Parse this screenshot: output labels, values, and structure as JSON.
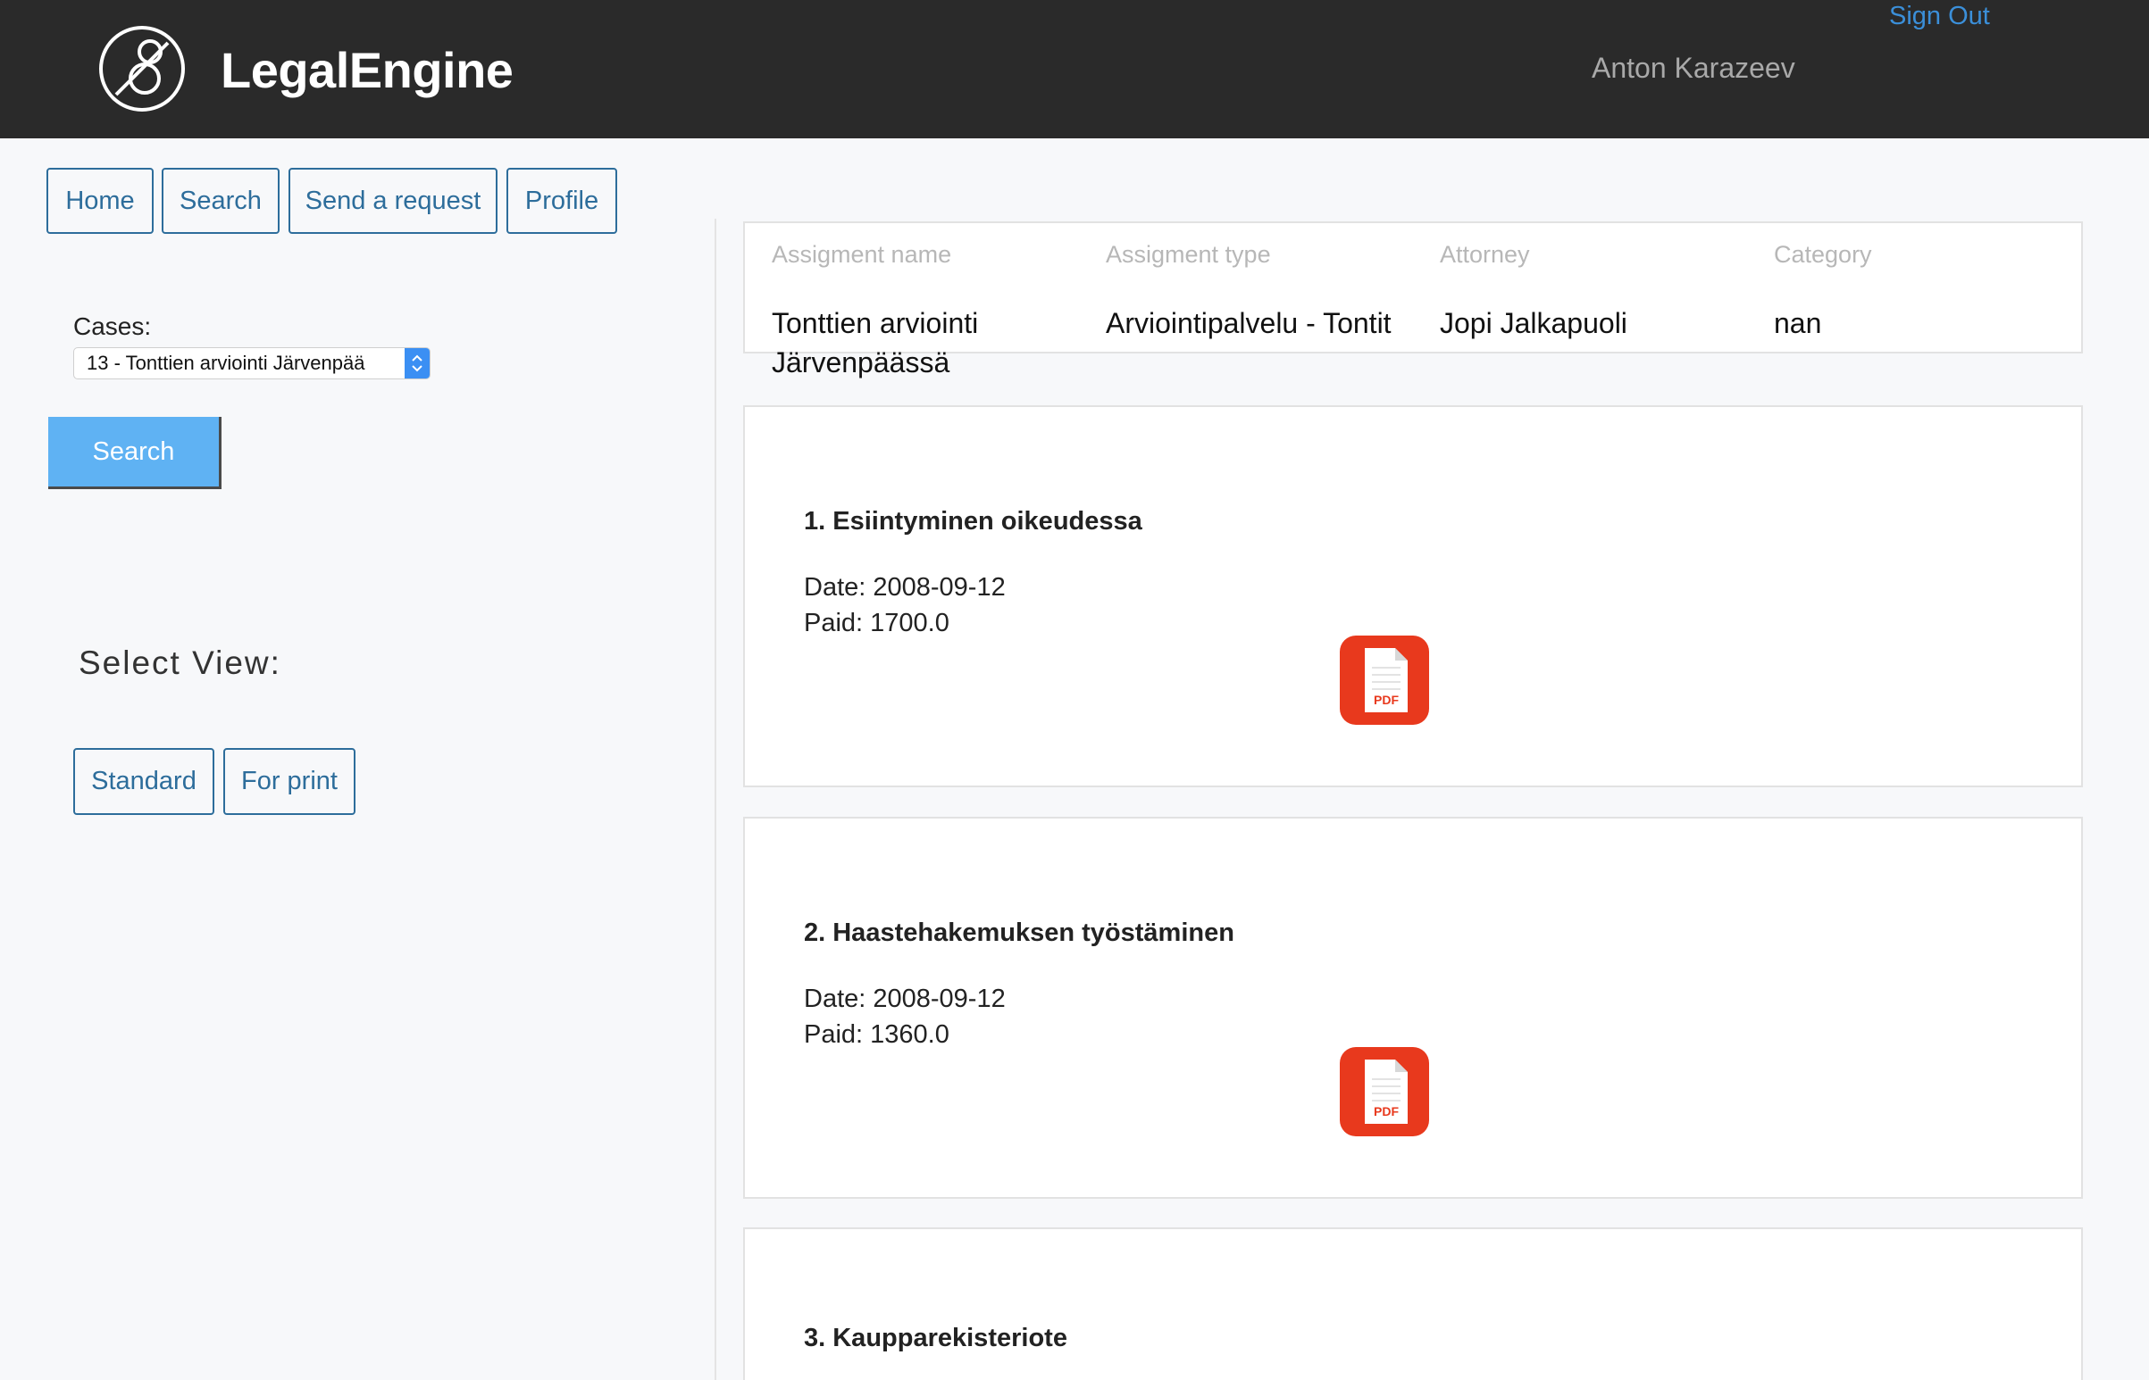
{
  "header": {
    "brand": "LegalEngine",
    "user_name": "Anton Karazeev",
    "sign_out": "Sign Out"
  },
  "nav": {
    "home": "Home",
    "search": "Search",
    "send_request": "Send a request",
    "profile": "Profile"
  },
  "sidebar": {
    "cases_label": "Cases:",
    "selected_case": "13 - Tonttien arviointi Järvenpää",
    "search_button": "Search",
    "select_view_label": "Select View:",
    "view_standard": "Standard",
    "view_print": "For print"
  },
  "assignment": {
    "headers": [
      "Assigment name",
      "Assigment type",
      "Attorney",
      "Category"
    ],
    "values": [
      "Tonttien arviointi Järvenpäässä",
      "Arviointipalvelu - Tontit",
      "Jopi Jalkapuoli",
      "nan"
    ]
  },
  "items": [
    {
      "title": "1. Esiintyminen oikeudessa",
      "date": "Date: 2008-09-12",
      "paid": "Paid: 1700.0",
      "pdf_label": "PDF"
    },
    {
      "title": "2. Haastehakemuksen työstäminen",
      "date": "Date: 2008-09-12",
      "paid": "Paid: 1360.0",
      "pdf_label": "PDF"
    },
    {
      "title": "3. Kaupparekisteriote"
    }
  ],
  "colors": {
    "topbar": "#2a2a2a",
    "link_blue": "#3b8fd9",
    "button_border": "#2d6d9b",
    "primary_button": "#5fb2f3",
    "pdf_red": "#e8391d"
  }
}
